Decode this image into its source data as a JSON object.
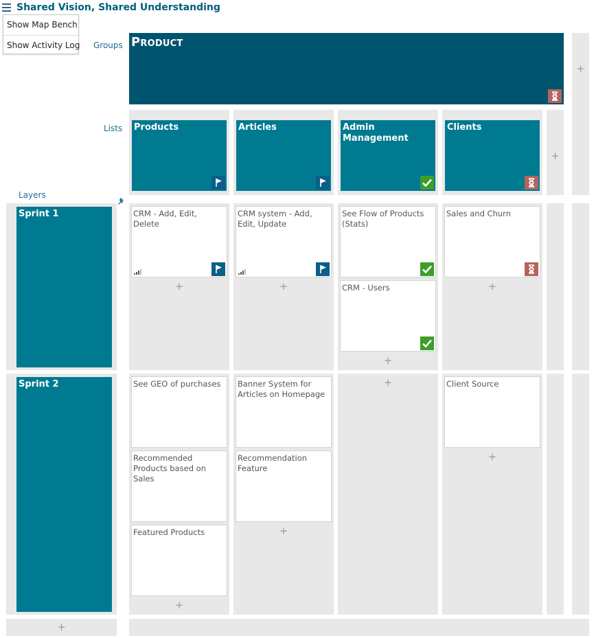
{
  "app": {
    "title": "Shared Vision, Shared Understanding",
    "menu_icon": "hamburger-icon"
  },
  "menu": {
    "items": [
      "Show Map Bench",
      "Show Activity Log"
    ]
  },
  "labels": {
    "groups": "Groups",
    "lists": "Lists",
    "layers": "Layers",
    "pin_icon": "pin-icon"
  },
  "add_symbol": "+",
  "group": {
    "title": "Product",
    "status_icon": "hourglass-icon"
  },
  "lists": [
    {
      "title": "Products",
      "status_icon": "flag-icon"
    },
    {
      "title": "Articles",
      "status_icon": "flag-icon"
    },
    {
      "title": "Admin Management",
      "status_icon": "check-icon"
    },
    {
      "title": "Clients",
      "status_icon": "hourglass-icon"
    }
  ],
  "layers": [
    {
      "title": "Sprint 1",
      "columns": [
        [
          {
            "text": "CRM - Add, Edit, Delete",
            "status_icon": "flag-icon",
            "signal_icon": "signal-bars-icon"
          }
        ],
        [
          {
            "text": "CRM system - Add, Edit, Update",
            "status_icon": "flag-icon",
            "signal_icon": "signal-bars-icon"
          }
        ],
        [
          {
            "text": "See Flow of Products (Stats)",
            "status_icon": "check-icon"
          },
          {
            "text": "CRM - Users",
            "status_icon": "check-icon"
          }
        ],
        [
          {
            "text": "Sales and Churn",
            "status_icon": "hourglass-icon"
          }
        ]
      ]
    },
    {
      "title": "Sprint 2",
      "columns": [
        [
          {
            "text": "See GEO of purchases"
          },
          {
            "text": "Recommended Products based on Sales"
          },
          {
            "text": "Featured Products"
          }
        ],
        [
          {
            "text": "Banner System for Articles on Homepage"
          },
          {
            "text": "Recommendation Feature"
          }
        ],
        [],
        [
          {
            "text": "Client Source"
          }
        ]
      ]
    }
  ],
  "colors": {
    "group_card": "#005470",
    "list_card": "#007a90",
    "flag": "#0a5f8a",
    "check": "#3d9e2a",
    "hourglass": "#b5645d",
    "lane": "#e8e8e8"
  }
}
